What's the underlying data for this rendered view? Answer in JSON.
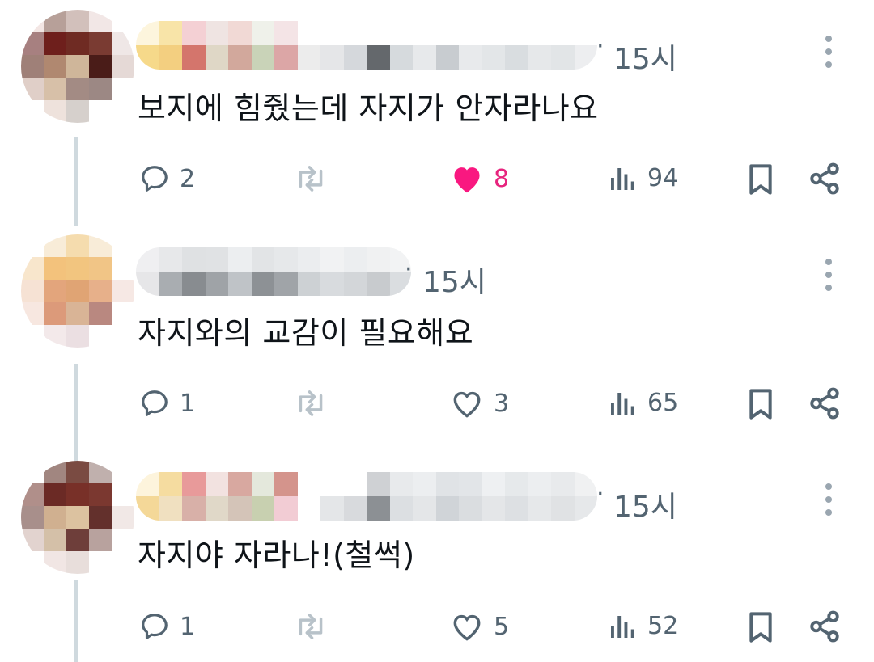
{
  "colors": {
    "muted": "#536471",
    "like_active": "#f91880",
    "thread_line": "#cfd9de"
  },
  "posts": [
    {
      "time": "15시",
      "text": "보지에 힘줬는데 자지가 안자라나요",
      "replies": "2",
      "likes": "8",
      "liked": true,
      "views": "94",
      "avatar_pixels": [
        "#f3e6e4",
        "#b7a099",
        "#d2c0bb",
        "#f2e7e6",
        "#ffffff",
        "#a78080",
        "#6e1f1c",
        "#6f2b23",
        "#7a3b32",
        "#efe7e6",
        "#9f8078",
        "#b08870",
        "#cfb69a",
        "#4a1c18",
        "#e5d9d6",
        "#e0cfc8",
        "#d7c0a8",
        "#a38b84",
        "#9c8884",
        "#ffffff",
        "#ffffff",
        "#eee2dc",
        "#d6d0cc",
        "#ffffff",
        "#ffffff"
      ],
      "name_pixels": [
        [
          "#fdf5dd",
          "#f6d98a"
        ],
        [
          "#f8e4a8",
          "#f3cf80"
        ],
        [
          "#f4d0d4",
          "#d4756c"
        ],
        [
          "#efe4e2",
          "#dfd7c6"
        ],
        [
          "#f1d9d5",
          "#d2a89c"
        ],
        [
          "#eff1ea",
          "#c9d3b8"
        ],
        [
          "#f4e4e6",
          "#dca6a6"
        ],
        [
          "#ffffff",
          "#ececec"
        ],
        [
          "#ffffff",
          "#e5e6e8"
        ],
        [
          "#ffffff",
          "#d5d8dc"
        ],
        [
          "#ffffff",
          "#64686c"
        ],
        [
          "#ffffff",
          "#d6dadd"
        ],
        [
          "#ffffff",
          "#e7e9eb"
        ],
        [
          "#ffffff",
          "#c8ccd0"
        ],
        [
          "#ffffff",
          "#e8eaec"
        ],
        [
          "#ffffff",
          "#e3e6e8"
        ],
        [
          "#ffffff",
          "#d9dde0"
        ],
        [
          "#ffffff",
          "#e6e8ea"
        ],
        [
          "#ffffff",
          "#e2e5e7"
        ],
        [
          "#ffffff",
          "#edeef0"
        ]
      ]
    },
    {
      "time": "15시",
      "text": "자지와의 교감이 필요해요",
      "replies": "1",
      "likes": "3",
      "liked": false,
      "views": "65",
      "avatar_pixels": [
        "#ffffff",
        "#f8ecd8",
        "#f5dcae",
        "#f8ecd8",
        "#ffffff",
        "#f8e6cc",
        "#f3c27c",
        "#f2c57f",
        "#f1c586",
        "#ffffff",
        "#f6e2d4",
        "#e3a57c",
        "#e0a474",
        "#e7b08a",
        "#f6e8e4",
        "#f7e7e0",
        "#dc9a7a",
        "#d9b496",
        "#b98880",
        "#ffffff",
        "#ffffff",
        "#f3e9ea",
        "#ebdfe2",
        "#ffffff",
        "#ffffff"
      ],
      "name_pixels": [
        [
          "#efeff1",
          "#e6e6e8"
        ],
        [
          "#e7e8ea",
          "#a9adb1"
        ],
        [
          "#dfe1e3",
          "#888c90"
        ],
        [
          "#e0e2e4",
          "#9fa3a7"
        ],
        [
          "#eceef0",
          "#bfc3c7"
        ],
        [
          "#e2e4e6",
          "#8d9195"
        ],
        [
          "#e6e8ea",
          "#a0a4a8"
        ],
        [
          "#ebedef",
          "#cdd1d4"
        ],
        [
          "#f1f2f3",
          "#d8dbde"
        ],
        [
          "#eceef0",
          "#d3d6d9"
        ],
        [
          "#f0f1f2",
          "#c8cbce"
        ],
        [
          "#f2f3f4",
          "#dadde0"
        ]
      ]
    },
    {
      "time": "15시",
      "text": "자지야 자라나!(철썩)",
      "replies": "1",
      "likes": "5",
      "liked": false,
      "views": "52",
      "avatar_pixels": [
        "#ffffff",
        "#a18680",
        "#7a4b42",
        "#c0b0ad",
        "#ffffff",
        "#b08f8a",
        "#6b2a25",
        "#783028",
        "#7b3830",
        "#ffffff",
        "#a88f8b",
        "#d0b090",
        "#dcc2a0",
        "#63302c",
        "#f1e8e6",
        "#e2d3cf",
        "#d4c0a8",
        "#6e3e3a",
        "#b8a29e",
        "#ffffff",
        "#ffffff",
        "#f1e6e4",
        "#e8dedb",
        "#ffffff",
        "#ffffff"
      ],
      "name_pixels": [
        [
          "#fdf4dc",
          "#f4d898"
        ],
        [
          "#f5dca0",
          "#f0e0c0"
        ],
        [
          "#e89a9a",
          "#d8b0a8"
        ],
        [
          "#f2e2e0",
          "#e0d8c8"
        ],
        [
          "#d8a8a0",
          "#d4c4b8"
        ],
        [
          "#e4e8dc",
          "#c8d0b0"
        ],
        [
          "#d4948c",
          "#f2ccd4"
        ],
        [
          "#ffffff",
          "#ffffff"
        ],
        [
          "#ffffff",
          "#e4e6e8"
        ],
        [
          "#ffffff",
          "#d8dadd"
        ],
        [
          "#cfd1d4",
          "#8c9094"
        ],
        [
          "#e8eaec",
          "#dcdfe2"
        ],
        [
          "#eceef0",
          "#e4e6e8"
        ],
        [
          "#e0e3e6",
          "#d0d4d8"
        ],
        [
          "#e2e5e8",
          "#dadde0"
        ],
        [
          "#eef0f2",
          "#e4e6e8"
        ],
        [
          "#e6e9eb",
          "#dde0e3"
        ],
        [
          "#eceef0",
          "#e6e8ea"
        ],
        [
          "#e8eaec",
          "#e0e2e4"
        ],
        [
          "#f0f1f2",
          "#e6e8ea"
        ]
      ]
    }
  ],
  "icons": {
    "reply": "speech-bubble-icon",
    "repost": "repost-arrows-icon",
    "like": "heart-icon",
    "views": "bar-chart-icon",
    "bookmark": "bookmark-icon",
    "share": "share-nodes-icon",
    "more": "more-vertical-icon"
  }
}
